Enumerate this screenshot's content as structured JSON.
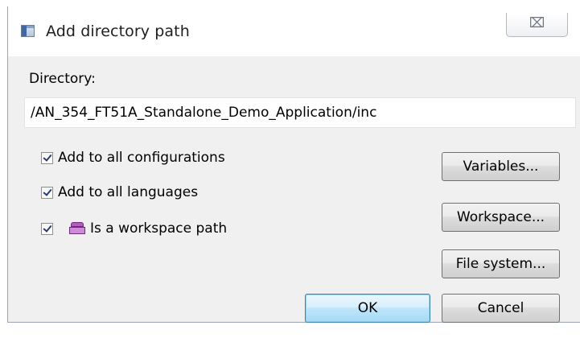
{
  "window": {
    "title": "Add directory path",
    "close_glyph": "⌧"
  },
  "directory": {
    "label": "Directory:",
    "value": "/AN_354_FT51A_Standalone_Demo_Application/inc"
  },
  "options": [
    {
      "label": "Add to all configurations",
      "checked": true
    },
    {
      "label": "Add to all languages",
      "checked": true
    },
    {
      "label": "Is a workspace path",
      "checked": true,
      "icon": "workspace-icon"
    }
  ],
  "buttons": {
    "variables": "Variables...",
    "workspace": "Workspace...",
    "file_system": "File system...",
    "ok": "OK",
    "cancel": "Cancel"
  },
  "colors": {
    "dialog_bg": "#f0f0f0",
    "default_button": "#3c7fb1",
    "workspace_icon": "#b45cc0"
  }
}
